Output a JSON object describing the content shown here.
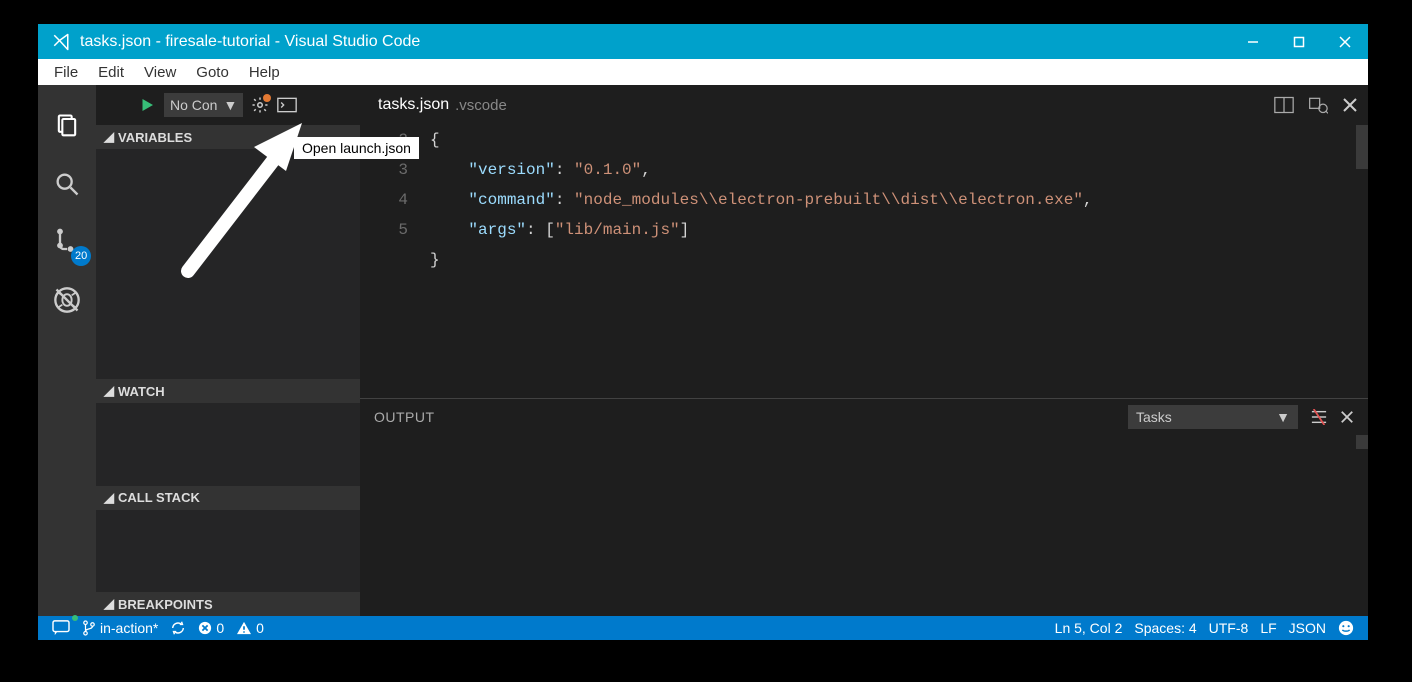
{
  "title": "tasks.json - firesale-tutorial - Visual Studio Code",
  "menu": {
    "items": [
      "File",
      "Edit",
      "View",
      "Goto",
      "Help"
    ]
  },
  "activity": {
    "git_badge": "20"
  },
  "debug": {
    "config_label": "No Con",
    "tooltip": "Open launch.json"
  },
  "panels": {
    "variables": "VARIABLES",
    "watch": "WATCH",
    "callstack": "CALL STACK",
    "breakpoints": "BREAKPOINTS"
  },
  "tab": {
    "name": "tasks.json",
    "path": ".vscode"
  },
  "code": {
    "lines": [
      "",
      "2",
      "3",
      "4",
      "5"
    ],
    "l1": "{",
    "k_version": "\"version\"",
    "v_version": "\"0.1.0\"",
    "k_command": "\"command\"",
    "v_command": "\"node_modules\\\\electron-prebuilt\\\\dist\\\\electron.exe\"",
    "k_args": "\"args\"",
    "v_args": "\"lib/main.js\"",
    "l5": "}"
  },
  "output": {
    "title": "OUTPUT",
    "channel": "Tasks"
  },
  "status": {
    "branch": "in-action*",
    "errors": "0",
    "warnings": "0",
    "ln_col": "Ln 5, Col 2",
    "spaces": "Spaces: 4",
    "encoding": "UTF-8",
    "eol": "LF",
    "lang": "JSON"
  }
}
